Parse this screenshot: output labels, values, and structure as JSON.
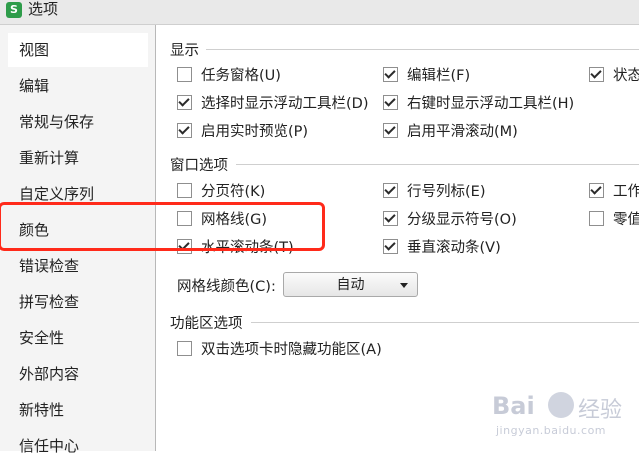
{
  "window": {
    "title": "选项",
    "app_icon": "S"
  },
  "sidebar": {
    "items": [
      {
        "label": "视图",
        "selected": true
      },
      {
        "label": "编辑"
      },
      {
        "label": "常规与保存"
      },
      {
        "label": "重新计算"
      },
      {
        "label": "自定义序列"
      },
      {
        "label": "颜色"
      },
      {
        "label": "错误检查"
      },
      {
        "label": "拼写检查"
      },
      {
        "label": "安全性"
      },
      {
        "label": "外部内容"
      },
      {
        "label": "新特性"
      },
      {
        "label": "信任中心"
      }
    ]
  },
  "display": {
    "title": "显示",
    "options": [
      {
        "label": "任务窗格(U)",
        "checked": false
      },
      {
        "label": "编辑栏(F)",
        "checked": true
      },
      {
        "label": "状态",
        "checked": true
      },
      {
        "label": "选择时显示浮动工具栏(D)",
        "checked": true
      },
      {
        "label": "右键时显示浮动工具栏(H)",
        "checked": true
      },
      {
        "label": "启用实时预览(P)",
        "checked": true
      },
      {
        "label": "启用平滑滚动(M)",
        "checked": true
      }
    ]
  },
  "window_options": {
    "title": "窗口选项",
    "options": [
      {
        "label": "分页符(K)",
        "checked": false
      },
      {
        "label": "行号列标(E)",
        "checked": true
      },
      {
        "label": "工作",
        "checked": true
      },
      {
        "label": "网格线(G)",
        "checked": false
      },
      {
        "label": "分级显示符号(O)",
        "checked": true
      },
      {
        "label": "零值",
        "checked": false
      },
      {
        "label": "水平滚动条(T)",
        "checked": true
      },
      {
        "label": "垂直滚动条(V)",
        "checked": true
      }
    ],
    "gridline_color_label": "网格线颜色(C):",
    "gridline_color_value": "自动"
  },
  "ribbon_options": {
    "title": "功能区选项",
    "options": [
      {
        "label": "双击选项卡时隐藏功能区(A)",
        "checked": false
      }
    ]
  },
  "watermark": {
    "brand": "Bai",
    "brand_cn": "经验",
    "url": "jingyan.baidu.com"
  },
  "colors": {
    "highlight": "#ff2a1a",
    "selected_bg": "#ffffff",
    "sidebar_bg": "#f4f4f4"
  }
}
